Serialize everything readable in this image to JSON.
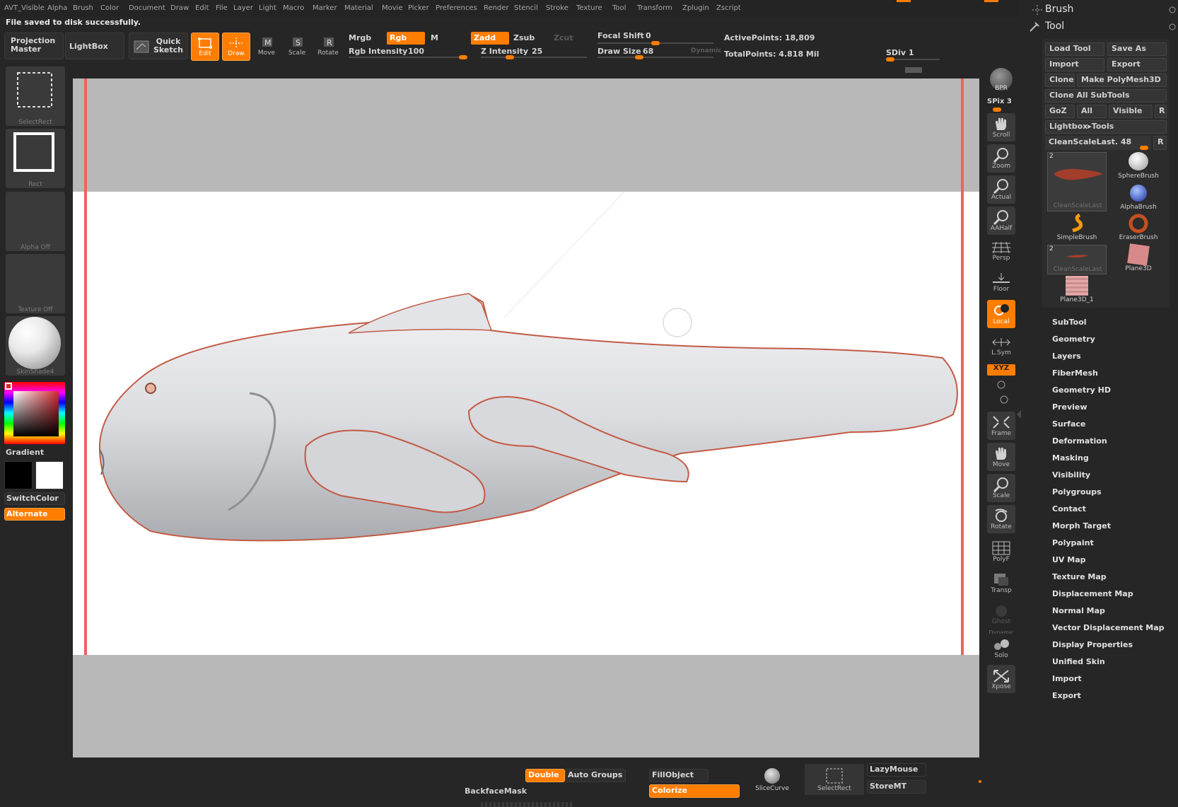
{
  "menu": [
    "AVT_Visible",
    "Alpha",
    "Brush",
    "Color",
    "Document",
    "Draw",
    "Edit",
    "File",
    "Layer",
    "Light",
    "Macro",
    "Marker",
    "Material",
    "Movie",
    "Picker",
    "Preferences",
    "Render",
    "Stencil",
    "Stroke",
    "Texture",
    "Tool",
    "Transform",
    "Zplugin",
    "Zscript"
  ],
  "notification": "File saved to disk successfully.",
  "toolbar": {
    "projection_master": "Projection Master",
    "lightbox": "LightBox",
    "quick_sketch": "Quick Sketch",
    "edit": "Edit",
    "draw": "Draw",
    "move": "Move",
    "scale": "Scale",
    "rotate": "Rotate",
    "mrgb": "Mrgb",
    "rgb": "Rgb",
    "m": "M",
    "zadd": "Zadd",
    "zsub": "Zsub",
    "zcut": "Zcut",
    "rgb_intensity_label": "Rgb Intensity",
    "rgb_intensity_value": "100",
    "z_intensity_label": "Z Intensity",
    "z_intensity_value": "25",
    "focal_shift_label": "Focal Shift",
    "focal_shift_value": "0",
    "draw_size_label": "Draw Size",
    "draw_size_value": "68",
    "dynamic": "Dynamic",
    "active_points": "ActivePoints: 18,809",
    "total_points": "TotalPoints: 4.818 Mil",
    "sdiv": "SDiv 1",
    "rgb_intensity_fraction": 1.0,
    "z_intensity_fraction": 0.25,
    "focal_shift_fraction": 0.5,
    "draw_size_fraction": 0.35
  },
  "left_shelf": {
    "select_rect": "SelectRect",
    "rect": "Rect",
    "alpha": "Alpha  Off",
    "texture": "Texture  Off",
    "material": "SkinShade4",
    "gradient": "Gradient",
    "switch_color": "SwitchColor",
    "alternate": "Alternate"
  },
  "right_shelf": {
    "bpr": "BPR",
    "spix": "SPix 3",
    "scroll": "Scroll",
    "zoom": "Zoom",
    "actual": "Actual",
    "aahalf": "AAHalf",
    "persp": "Persp",
    "floor": "Floor",
    "local": "Local",
    "lsym": "L.Sym",
    "xyz": "XYZ",
    "frame": "Frame",
    "move": "Move",
    "scale": "Scale",
    "rotate": "Rotate",
    "polyf": "PolyF",
    "transp": "Transp",
    "ghost": "Ghost",
    "dynamic": "Dynamic",
    "solo": "Solo",
    "xpose": "Xpose"
  },
  "palette": {
    "brush_title": "Brush",
    "tool_title": "Tool",
    "load_tool": "Load Tool",
    "save_as": "Save As",
    "import": "Import",
    "export": "Export",
    "clone": "Clone",
    "make_polymesh": "Make PolyMesh3D",
    "clone_all": "Clone  All  SubTools",
    "goz": "GoZ",
    "all": "All",
    "visible": "Visible",
    "r": "R",
    "lightbox_tools": "Lightbox▸Tools",
    "current_tool": "CleanScaleLast. 48",
    "thumbs": [
      "CleanScaleLast",
      "SphereBrush",
      "AlphaBrush",
      "SimpleBrush",
      "EraserBrush",
      "CleanScaleLast",
      "Plane3D",
      "Plane3D_1"
    ],
    "thumb_badge": "2",
    "sections": [
      "SubTool",
      "Geometry",
      "Layers",
      "FiberMesh",
      "Geometry HD",
      "Preview",
      "Surface",
      "Deformation",
      "Masking",
      "Visibility",
      "Polygroups",
      "Contact",
      "Morph Target",
      "Polypaint",
      "UV Map",
      "Texture Map",
      "Displacement Map",
      "Normal Map",
      "Vector Displacement Map",
      "Display Properties",
      "Unified Skin",
      "Import",
      "Export"
    ]
  },
  "bottom": {
    "double": "Double",
    "auto_groups": "Auto Groups",
    "backface_mask": "BackfaceMask",
    "fill_object": "FillObject",
    "colorize": "Colorize",
    "slice_curve": "SliceCurve",
    "select_rect": "SelectRect",
    "lazy_mouse": "LazyMouse",
    "store_mt": "StoreMT"
  },
  "colors": {
    "accent": "#ff7d00",
    "background": "#262626",
    "canvas_gray": "#b8b8b8",
    "canvas_white": "#ffffff",
    "primary_color": "#000000",
    "secondary_color": "#ffffff"
  }
}
